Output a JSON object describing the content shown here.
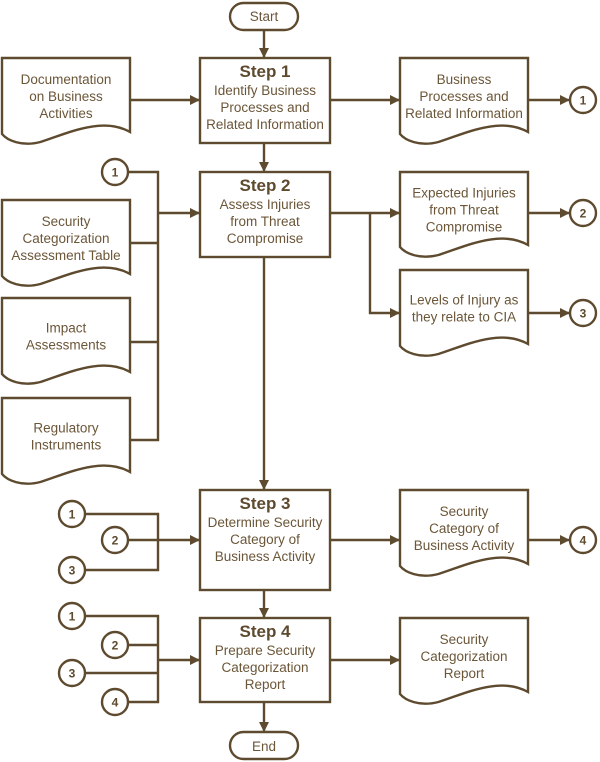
{
  "colors": {
    "line": "#5e4a2e",
    "text": "#6b5638"
  },
  "start": "Start",
  "end": "End",
  "steps": [
    {
      "title": "Step 1",
      "lines": [
        "Identify Business",
        "Processes and",
        "Related Information"
      ]
    },
    {
      "title": "Step 2",
      "lines": [
        "Assess Injuries",
        "from Threat",
        "Compromise"
      ]
    },
    {
      "title": "Step 3",
      "lines": [
        "Determine Security",
        "Category of",
        "Business Activity"
      ]
    },
    {
      "title": "Step 4",
      "lines": [
        "Prepare Security",
        "Categorization",
        "Report"
      ]
    }
  ],
  "inputs": [
    {
      "lines": [
        "Documentation",
        "on Business",
        "Activities"
      ]
    },
    {
      "lines": [
        "Security",
        "Categorization",
        "Assessment Table"
      ]
    },
    {
      "lines": [
        "Impact",
        "Assessments"
      ]
    },
    {
      "lines": [
        "Regulatory",
        "Instruments"
      ]
    }
  ],
  "outputs": [
    {
      "lines": [
        "Business",
        "Processes and",
        "Related Information"
      ]
    },
    {
      "lines": [
        "Expected Injuries",
        "from Threat",
        "Compromise"
      ]
    },
    {
      "lines": [
        "Levels of Injury as",
        "they relate to CIA"
      ]
    },
    {
      "lines": [
        "Security",
        "Category of",
        "Business Activity"
      ]
    },
    {
      "lines": [
        "Security",
        "Categorization",
        "Report"
      ]
    }
  ],
  "connectors": {
    "c1": "1",
    "c2": "2",
    "c3": "3",
    "c4": "4"
  }
}
